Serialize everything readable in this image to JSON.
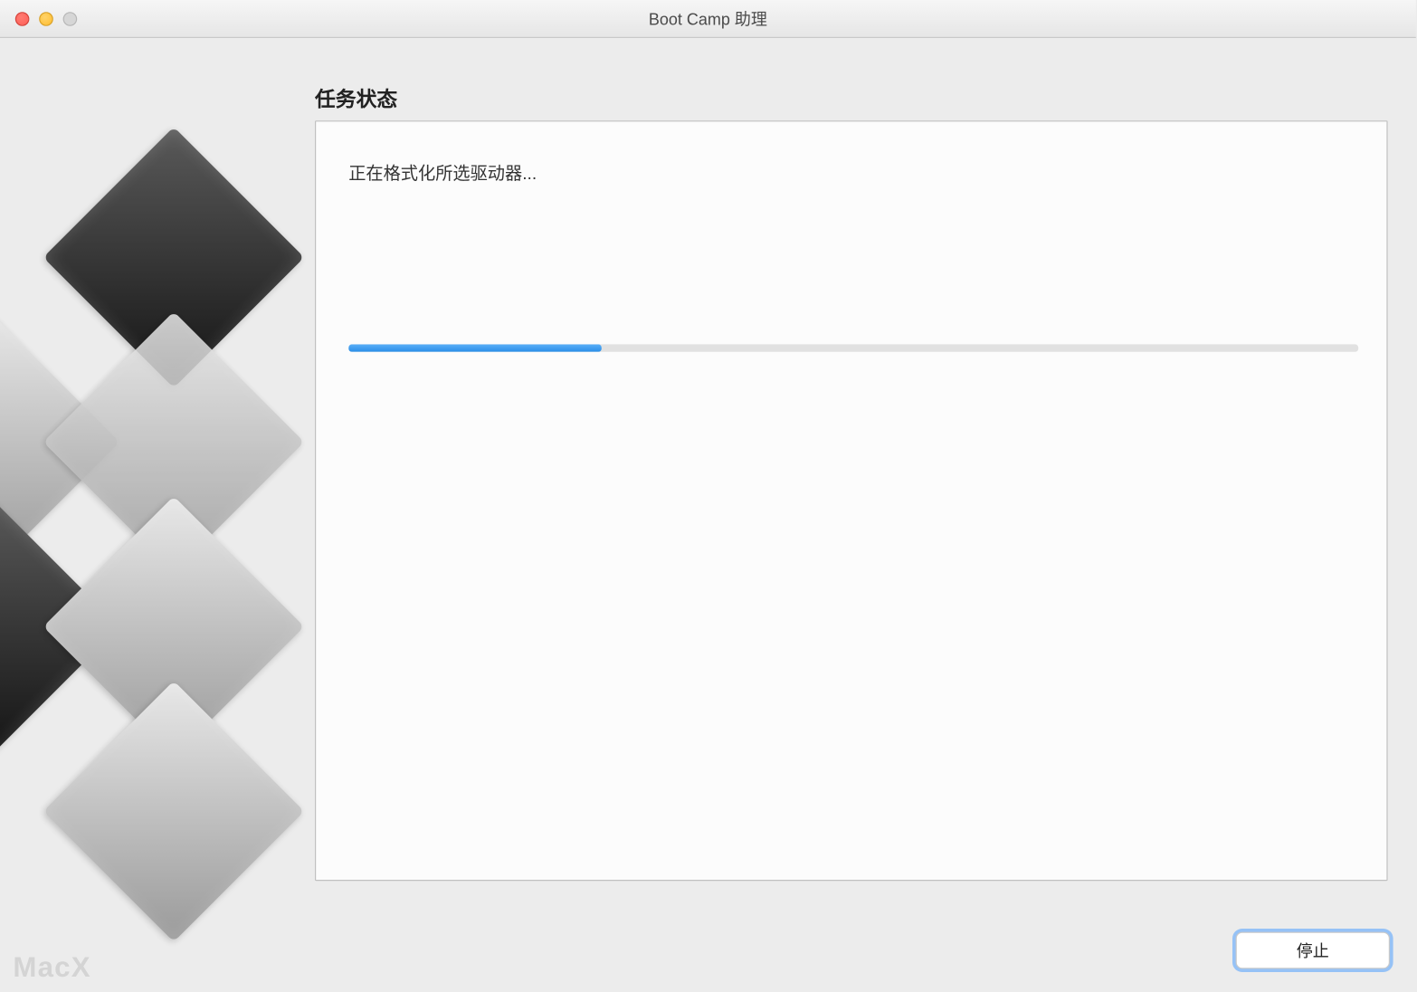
{
  "window": {
    "title": "Boot Camp 助理"
  },
  "panel": {
    "heading": "任务状态",
    "status_text": "正在格式化所选驱动器...",
    "progress_percent": 25
  },
  "buttons": {
    "stop_label": "停止"
  },
  "watermark": "MacX"
}
